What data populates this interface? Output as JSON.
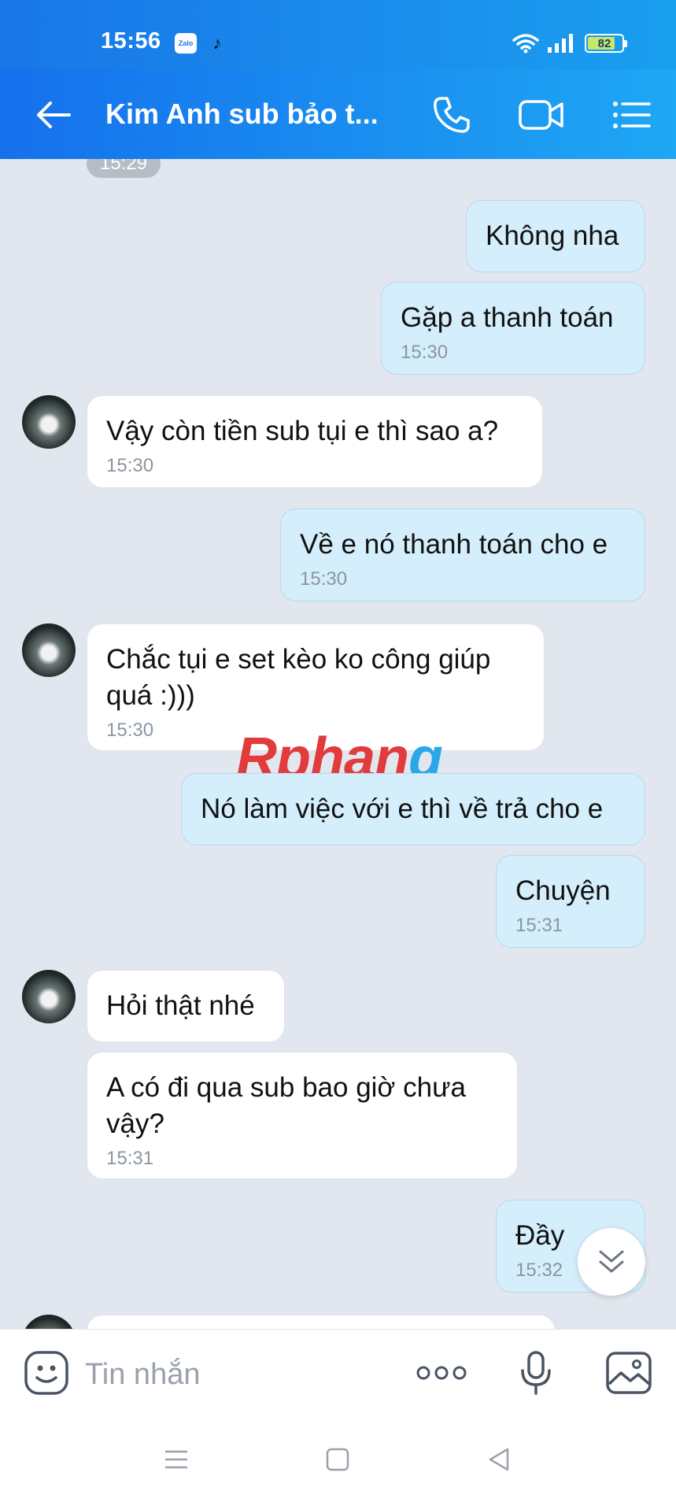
{
  "status_bar": {
    "time": "15:56",
    "zalo_badge": "Zalo",
    "battery_level": 82
  },
  "header": {
    "title": "Kim Anh sub bảo t..."
  },
  "chat": {
    "top_time": "15:29",
    "messages": [
      {
        "dir": "out",
        "text": "Không nha",
        "time": ""
      },
      {
        "dir": "out",
        "text": "Gặp a thanh toán",
        "time": "15:30"
      },
      {
        "dir": "in",
        "text": "Vậy còn tiền sub tụi e thì sao a?",
        "time": "15:30"
      },
      {
        "dir": "out",
        "text": "Về e nó thanh toán cho e",
        "time": "15:30"
      },
      {
        "dir": "in",
        "text": "Chắc tụi e set kèo ko công giúp quá :)))",
        "time": "15:30"
      },
      {
        "dir": "out",
        "text": "Nó làm việc với e thì về trả cho e",
        "time": ""
      },
      {
        "dir": "out",
        "text": "Chuyện",
        "time": "15:31"
      },
      {
        "dir": "in",
        "text": "Hỏi thật nhé",
        "time": ""
      },
      {
        "dir": "in",
        "text": "A có đi qua sub bao giờ chưa vậy?",
        "time": "15:31"
      },
      {
        "dir": "out",
        "text": "Đầy",
        "time": "15:32"
      }
    ],
    "watermark": {
      "part1": "Rphan",
      "part2": "g"
    }
  },
  "composer": {
    "placeholder": "Tin nhắn"
  },
  "colors": {
    "header_start": "#1570ec",
    "header_end": "#1ea7f4",
    "outgoing_bubble": "#d5eefc",
    "incoming_bubble": "#ffffff",
    "chat_background": "#e2e7ef"
  }
}
